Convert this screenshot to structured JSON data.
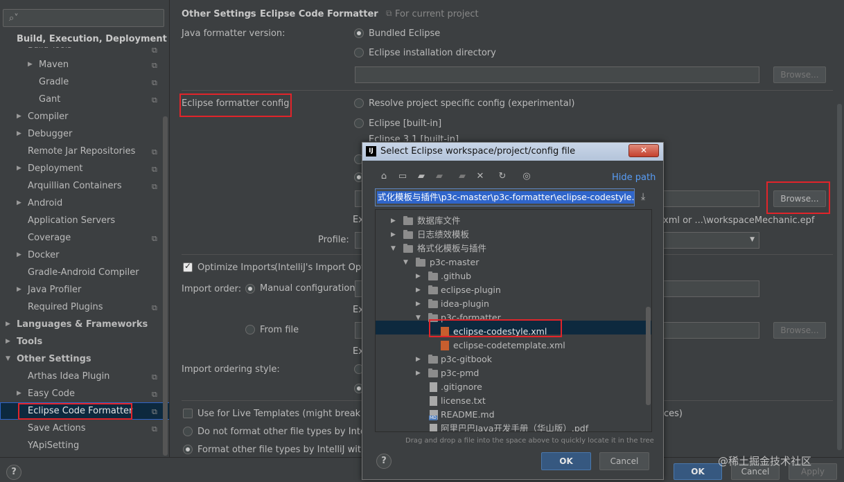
{
  "sidebar": {
    "search_placeholder": "",
    "section_header": "Build, Execution, Deployment",
    "partial_item": "Build Tools",
    "items": [
      {
        "label": "Maven"
      },
      {
        "label": "Gradle"
      },
      {
        "label": "Gant"
      },
      {
        "label": "Compiler"
      },
      {
        "label": "Debugger"
      },
      {
        "label": "Remote Jar Repositories"
      },
      {
        "label": "Deployment"
      },
      {
        "label": "Arquillian Containers"
      },
      {
        "label": "Android"
      },
      {
        "label": "Application Servers"
      },
      {
        "label": "Coverage"
      },
      {
        "label": "Docker"
      },
      {
        "label": "Gradle-Android Compiler"
      },
      {
        "label": "Java Profiler"
      },
      {
        "label": "Required Plugins"
      },
      {
        "label": "Languages & Frameworks"
      },
      {
        "label": "Tools"
      },
      {
        "label": "Other Settings"
      },
      {
        "label": "Arthas Idea Plugin"
      },
      {
        "label": "Easy Code"
      },
      {
        "label": "Eclipse Code Formatter"
      },
      {
        "label": "Save Actions"
      },
      {
        "label": "YApiSetting"
      }
    ]
  },
  "breadcrumb": {
    "parent": "Other Settings",
    "current": "Eclipse Code Formatter",
    "scope": "For current project"
  },
  "settings": {
    "version_label": "Java formatter version:",
    "bundled": "Bundled Eclipse",
    "install_dir": "Eclipse installation directory",
    "browse": "Browse...",
    "config_label": "Eclipse formatter config",
    "resolve": "Resolve project specific config (experimental)",
    "builtin": "Eclipse [built-in]",
    "eclipse31": "Eclipse 3.1 [built-in]",
    "ex_partial": "Ex",
    "hint_tail": "xml or ...\\workspaceMechanic.epf",
    "profile_label": "Profile:",
    "optimize_imports": "Optimize Imports",
    "optimize_tail": "(IntelliJ's Import Opti",
    "import_order_label": "Import order:",
    "manual_config": "Manual configuration",
    "from_file": "From file",
    "import_style_label": "Import ordering style:",
    "live_templates": "Use for Live Templates (might break car",
    "live_tail": "ces)",
    "no_format_other": "Do not format other file types by IntelliJ",
    "format_other": "Format other file types by IntelliJ with thi"
  },
  "dialog": {
    "title": "Select Eclipse workspace/project/config file",
    "app_icon": "IJ",
    "close": "✕",
    "hide_path": "Hide path",
    "path": "式化模板与插件\\p3c-master\\p3c-formatter\\eclipse-codestyle.xml",
    "tree": [
      {
        "label": "数据库文件"
      },
      {
        "label": "日志绩效模板"
      },
      {
        "label": "格式化模板与插件"
      },
      {
        "label": "p3c-master"
      },
      {
        "label": ".github"
      },
      {
        "label": "eclipse-plugin"
      },
      {
        "label": "idea-plugin"
      },
      {
        "label": "p3c-formatter"
      },
      {
        "label": "eclipse-codestyle.xml"
      },
      {
        "label": "eclipse-codetemplate.xml"
      },
      {
        "label": "p3c-gitbook"
      },
      {
        "label": "p3c-pmd"
      },
      {
        "label": ".gitignore"
      },
      {
        "label": "license.txt"
      },
      {
        "label": "README.md"
      },
      {
        "label": "阿里巴巴Java开发手册（华山版）.pdf"
      }
    ],
    "dnd_hint": "Drag and drop a file into the space above to quickly locate it in the tree",
    "ok": "OK",
    "cancel": "Cancel",
    "help": "?"
  },
  "footer": {
    "help": "?",
    "ok": "OK",
    "cancel": "Cancel",
    "apply": "Apply",
    "watermark": "@稀土掘金技术社区"
  },
  "colors": {
    "background": "#3c3f41",
    "selection": "#0d293e",
    "accent_blue": "#589df6",
    "highlight_red": "#e2242a"
  }
}
